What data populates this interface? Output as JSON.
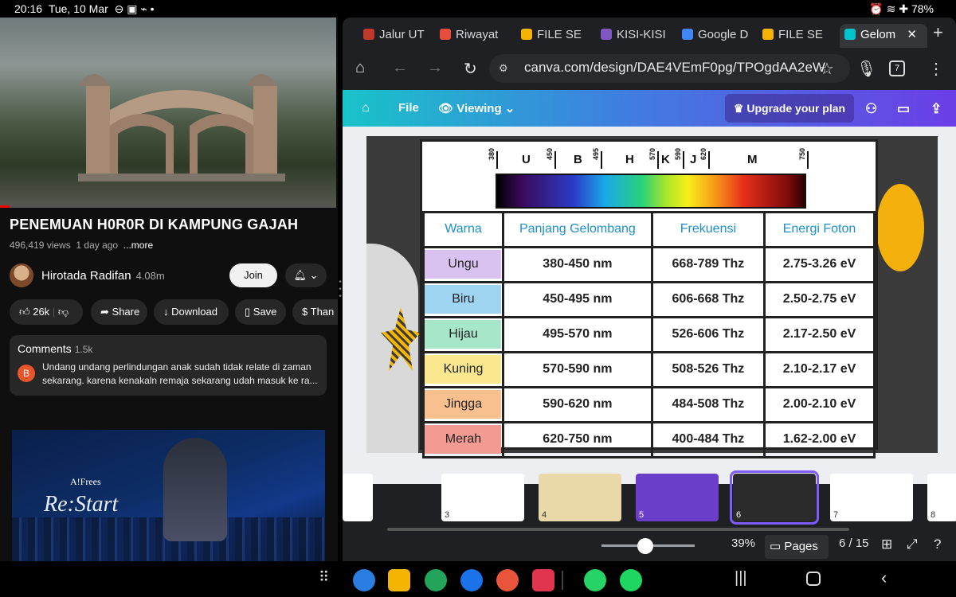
{
  "status": {
    "time": "20:16",
    "date": "Tue, 10 Mar",
    "battery": "78%"
  },
  "youtube": {
    "title": "PENEMUAN H0R0R DI KAMPUNG GAJAH",
    "views": "496,419 views",
    "age": "1 day ago",
    "more": "...more",
    "channel": "Hirotada Radifan",
    "subs": "4.08m",
    "join": "Join",
    "likes": "26k",
    "share": "Share",
    "download": "Download",
    "save": "Save",
    "thanks": "Than",
    "comments_label": "Comments",
    "comments_count": "1.5k",
    "comment_avatar": "B",
    "comment_text": "Undang undang perlindungan anak sudah tidak relate di zaman sekarang. karena kenakaln remaja sekarang udah masuk ke ra...",
    "ad_brand": "A!Frees",
    "ad_title": "Re:Start"
  },
  "browser": {
    "tabs": [
      {
        "label": "Jalur UT",
        "color": "#c0392b"
      },
      {
        "label": "Riwayat",
        "color": "#e74c3c"
      },
      {
        "label": "FILE SE",
        "color": "#f4b400"
      },
      {
        "label": "KISI-KISI",
        "color": "#7e57c2"
      },
      {
        "label": "Google D",
        "color": "#4285f4"
      },
      {
        "label": "FILE SE",
        "color": "#f4b400"
      },
      {
        "label": "Gelom",
        "color": "#00c4cc"
      }
    ],
    "url": "canva.com/design/DAE4VEmF0pg/TPOgdAA2eW",
    "tab_count": "7"
  },
  "canva": {
    "file": "File",
    "viewing": "Viewing",
    "upgrade": "Upgrade your plan",
    "zoom": "39%",
    "pages": "Pages",
    "page_indicator": "6 / 15"
  },
  "spectrum": {
    "letters": [
      "U",
      "B",
      "H",
      "K",
      "J",
      "M"
    ],
    "numbers": [
      "380",
      "450",
      "495",
      "570",
      "590",
      "620",
      "750"
    ]
  },
  "table": {
    "headers": [
      "Warna",
      "Panjang Gelombang",
      "Frekuensi",
      "Energi Foton"
    ],
    "rows": [
      {
        "warna": "Ungu",
        "pg": "380-450 nm",
        "f": "668-789 Thz",
        "e": "2.75-3.26 eV",
        "color": "#d9c2f0"
      },
      {
        "warna": "Biru",
        "pg": "450-495 nm",
        "f": "606-668 Thz",
        "e": "2.50-2.75 eV",
        "color": "#9ed3f2"
      },
      {
        "warna": "Hijau",
        "pg": "495-570 nm",
        "f": "526-606 Thz",
        "e": "2.17-2.50 eV",
        "color": "#a8e6c9"
      },
      {
        "warna": "Kuning",
        "pg": "570-590 nm",
        "f": "508-526 Thz",
        "e": "2.10-2.17 eV",
        "color": "#fbe88e"
      },
      {
        "warna": "Jingga",
        "pg": "590-620 nm",
        "f": "484-508 Thz",
        "e": "2.00-2.10 eV",
        "color": "#f9c08f"
      },
      {
        "warna": "Merah",
        "pg": "620-750 nm",
        "f": "400-484 Thz",
        "e": "1.62-2.00 eV",
        "color": "#f39a92"
      }
    ]
  },
  "thumbnails": [
    "",
    "3",
    "4",
    "5",
    "6",
    "7",
    "8"
  ]
}
